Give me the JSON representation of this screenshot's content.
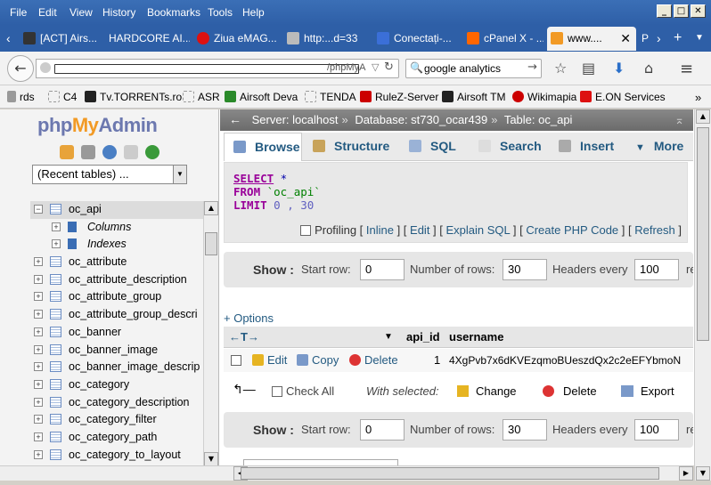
{
  "menu": [
    "File",
    "Edit",
    "View",
    "History",
    "Bookmarks",
    "Tools",
    "Help"
  ],
  "window_buttons": [
    "_",
    "□",
    "✕"
  ],
  "tabs": [
    {
      "label": "[ACT] Airs...",
      "color": "#333"
    },
    {
      "label": "HARDCORE AI...",
      "color": "#444"
    },
    {
      "label": "Ziua eMAG...",
      "color": "#d11"
    },
    {
      "label": "http:...d=33",
      "color": "#666"
    },
    {
      "label": "Conectați-...",
      "color": "#3b6fd8"
    },
    {
      "label": "cPanel X - ...",
      "color": "#f60"
    },
    {
      "label": "www.... ",
      "color": "#f29a25"
    },
    {
      "label": "P",
      "color": "#888"
    }
  ],
  "nav": {
    "url_suffix": "/phpMyA",
    "search_value": "google analytics"
  },
  "bookmarks": [
    {
      "label": "rds",
      "color": "#999"
    },
    {
      "label": "C4",
      "color": "#ccc"
    },
    {
      "label": "Tv.TORRENTs.ro",
      "color": "#222"
    },
    {
      "label": "ASR",
      "color": "#ccc"
    },
    {
      "label": "Airsoft Deva",
      "color": "#2a8a2a"
    },
    {
      "label": "TENDA",
      "color": "#ccc"
    },
    {
      "label": "RuleZ-Server",
      "color": "#c00"
    },
    {
      "label": "Airsoft TM",
      "color": "#222"
    },
    {
      "label": "Wikimapia",
      "color": "#c00"
    },
    {
      "label": "E.ON Services",
      "color": "#d11"
    }
  ],
  "sidebar": {
    "logo": {
      "php": "php",
      "my": "My",
      "admin": "Admin"
    },
    "recent_select": "(Recent tables) ...",
    "tree": [
      {
        "label": "oc_api",
        "expanded": true,
        "selected": true
      },
      {
        "label": "Columns",
        "child": true
      },
      {
        "label": "Indexes",
        "child": true
      },
      {
        "label": "oc_attribute"
      },
      {
        "label": "oc_attribute_description"
      },
      {
        "label": "oc_attribute_group"
      },
      {
        "label": "oc_attribute_group_descri"
      },
      {
        "label": "oc_banner"
      },
      {
        "label": "oc_banner_image"
      },
      {
        "label": "oc_banner_image_descrip"
      },
      {
        "label": "oc_category"
      },
      {
        "label": "oc_category_description"
      },
      {
        "label": "oc_category_filter"
      },
      {
        "label": "oc_category_path"
      },
      {
        "label": "oc_category_to_layout"
      }
    ]
  },
  "breadcrumb": {
    "server": "Server: localhost",
    "database": "Database: st730_ocar439",
    "table": "Table: oc_api"
  },
  "main_tabs": [
    {
      "label": "Browse",
      "active": true
    },
    {
      "label": "Structure"
    },
    {
      "label": "SQL"
    },
    {
      "label": "Search"
    },
    {
      "label": "Insert"
    },
    {
      "label": "More"
    }
  ],
  "sql": {
    "line1_kw": "SELECT",
    "line1_rest": " *",
    "line2_kw": "FROM",
    "line2_rest": " `oc_api`",
    "line3_kw": "LIMIT",
    "line3_rest": " 0 , 30"
  },
  "query_links": {
    "profiling": "Profiling",
    "inline": "Inline",
    "edit": "Edit",
    "explain": "Explain SQL",
    "php": "Create PHP Code",
    "refresh": "Refresh"
  },
  "nav_controls": {
    "show": "Show :",
    "start_label": "Start row:",
    "start_value": "0",
    "rows_label": "Number of rows:",
    "rows_value": "30",
    "headers_label": "Headers every",
    "headers_value": "100",
    "trailing": "re"
  },
  "options_link": "+ Options",
  "table": {
    "columns": [
      "api_id",
      "username"
    ],
    "rows": [
      {
        "api_id": "1",
        "username": "4XgPvb7x6dKVEzqmoBUeszdQx2c2eEFYbmoN"
      }
    ],
    "row_actions": {
      "edit": "Edit",
      "copy": "Copy",
      "delete": "Delete"
    }
  },
  "bulk": {
    "check_all": "Check All",
    "with_selected": "With selected:",
    "change": "Change",
    "delete": "Delete",
    "export": "Export"
  },
  "colors": {
    "accent": "#235a81",
    "titlebar": "#2e5fa7"
  }
}
